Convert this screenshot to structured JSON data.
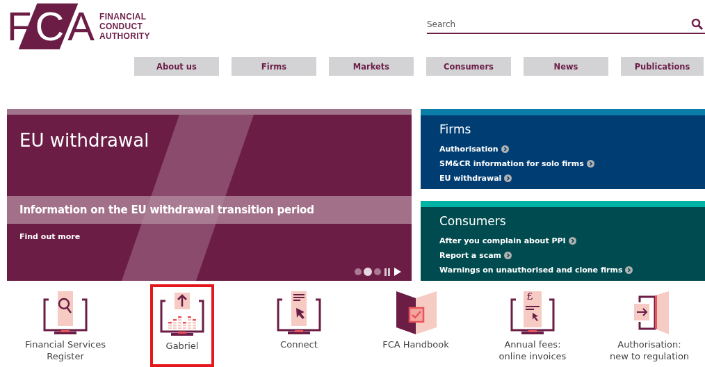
{
  "logo": {
    "letters": [
      "F",
      "C",
      "A"
    ],
    "name_lines": [
      "FINANCIAL",
      "CONDUCT",
      "AUTHORITY"
    ]
  },
  "search": {
    "placeholder": "Search"
  },
  "nav": [
    {
      "label": "About us"
    },
    {
      "label": "Firms"
    },
    {
      "label": "Markets"
    },
    {
      "label": "Consumers"
    },
    {
      "label": "News"
    },
    {
      "label": "Publications"
    }
  ],
  "hero": {
    "title": "EU withdrawal",
    "subtitle": "Information on the EU withdrawal transition period",
    "link": "Find out more",
    "dots": [
      {
        "selected": false
      },
      {
        "selected": true
      },
      {
        "selected": false
      }
    ]
  },
  "panels": [
    {
      "kind": "firms",
      "title": "Firms",
      "links": [
        "Authorisation",
        "SM&CR information for solo firms",
        "EU withdrawal"
      ]
    },
    {
      "kind": "consumers",
      "title": "Consumers",
      "links": [
        "After you complain about PPI",
        "Report a scam",
        "Warnings on unauthorised and clone firms"
      ]
    }
  ],
  "tiles": [
    {
      "kind": "search",
      "label_lines": [
        "Financial Services",
        "Register"
      ],
      "selected": false
    },
    {
      "kind": "upload",
      "label_lines": [
        "Gabriel"
      ],
      "selected": true
    },
    {
      "kind": "document",
      "label_lines": [
        "Connect"
      ],
      "selected": false
    },
    {
      "kind": "book",
      "label_lines": [
        "FCA Handbook"
      ],
      "selected": false
    },
    {
      "kind": "fees",
      "symbol": "£",
      "label_lines": [
        "Annual fees:",
        "online invoices"
      ],
      "selected": false
    },
    {
      "kind": "door",
      "label_lines": [
        "Authorisation:",
        "new to regulation"
      ],
      "selected": false
    }
  ]
}
